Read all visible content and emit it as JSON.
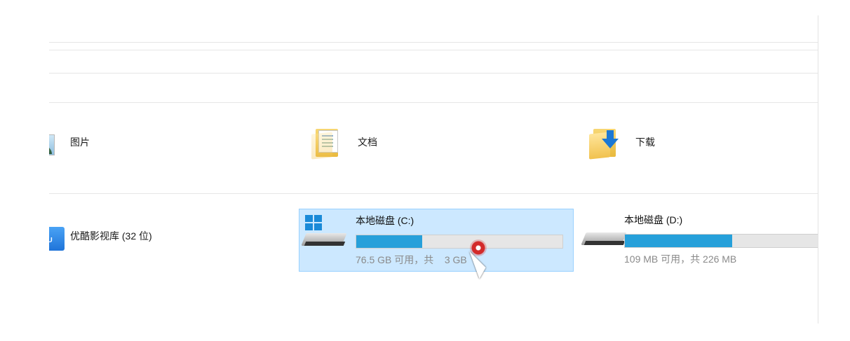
{
  "quick_access": {
    "items": [
      {
        "label": "图片",
        "icon": "pictures-folder-icon"
      },
      {
        "label": "文档",
        "icon": "documents-folder-icon"
      },
      {
        "label": "下载",
        "icon": "downloads-folder-icon"
      }
    ]
  },
  "devices": {
    "items": [
      {
        "label": "优酷影视库 (32 位)",
        "icon": "youku-library-icon"
      },
      {
        "label": "本地磁盘 (C:)",
        "space": "76.5 GB 可用，共",
        "space_tail": "3 GB",
        "usage_fraction": 0.32,
        "icon": "windows-drive-icon",
        "selected": true
      },
      {
        "label": "本地磁盘 (D:)",
        "space": "109 MB 可用，共 226 MB",
        "usage_fraction": 0.52,
        "icon": "drive-icon",
        "selected": false
      }
    ]
  },
  "colors": {
    "selection_bg": "#cce8ff",
    "selection_border": "#99d1ff",
    "usage_bar": "#26a0da",
    "cursor_ring": "#d32a2a"
  }
}
